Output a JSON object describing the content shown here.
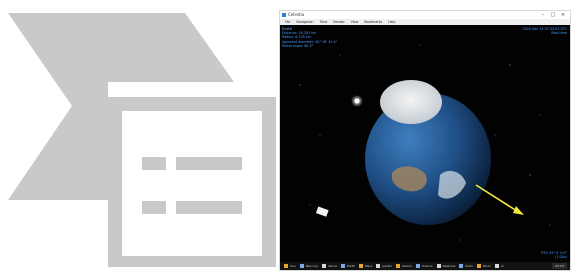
{
  "window": {
    "title": "Celestia"
  },
  "menu": [
    "File",
    "Navigation",
    "Time",
    "Render",
    "View",
    "Bookmarks",
    "Help"
  ],
  "info_top_left": {
    "name": "Earth",
    "lines": [
      "Distance: 18,203 km",
      "Radius: 6,378 km",
      "Apparent diameter: 40° 26' 41.5\"",
      "Phase angle: 90.5°"
    ]
  },
  "info_top_right": {
    "lines": [
      "2020 Dec 14 07:53:02 UTC",
      "Real time"
    ]
  },
  "info_bottom_right": {
    "lines": [
      "FOV: 45° 0' 0.0\"",
      "(1.00x)"
    ]
  },
  "taskbar": {
    "items": [
      "Sun",
      "Mercury",
      "Venus",
      "Earth",
      "Mars",
      "Jupiter",
      "Saturn",
      "Uranus",
      "Neptune",
      "Pluto",
      "Moon",
      "Io"
    ],
    "time": "07:53"
  }
}
